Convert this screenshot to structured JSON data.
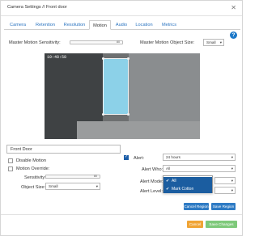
{
  "window": {
    "title": "Camera Settings // Front door"
  },
  "tabs": [
    {
      "label": "Camera"
    },
    {
      "label": "Retention"
    },
    {
      "label": "Resolution"
    },
    {
      "label": "Motion"
    },
    {
      "label": "Audio"
    },
    {
      "label": "Location"
    },
    {
      "label": "Metrics"
    }
  ],
  "active_tab": "Motion",
  "motion": {
    "master_sensitivity_label": "Master Motion Sensitivity:",
    "master_sensitivity_value": "80",
    "master_object_size_label": "Master Motion Object Size:",
    "master_object_size_value": "Small"
  },
  "video": {
    "timestamp": "10:48:58"
  },
  "region": {
    "name": "Front Door",
    "disable_motion_label": "Disable Motion",
    "motion_override_label": "Motion Override:",
    "sensitivity_label": "Sensitivity:",
    "sensitivity_value": "80",
    "object_size_label": "Object Size:",
    "object_size_value": "Small",
    "disable_motion_checked": false,
    "motion_override_checked": false
  },
  "alert": {
    "alert_label": "Alert:",
    "alert_checked": true,
    "alert_value": "24 hours",
    "alert_who_label": "Alert Who:",
    "alert_who_value": "All",
    "alert_who_options": [
      {
        "label": "All",
        "checked": true
      },
      {
        "label": "Mark Cotton",
        "checked": true
      }
    ],
    "alert_mode_label": "Alert Mode:",
    "alert_level_label": "Alert Level:"
  },
  "buttons": {
    "cancel_region": "Cancel Region",
    "save_region": "Save Region",
    "cancel": "Cancel",
    "save_changes": "Save Changes"
  },
  "colors": {
    "primary": "#2e7bc4",
    "warning": "#f0a435",
    "success": "#7ec97a",
    "region_fill": "#8cd1e8",
    "dropdown_highlight": "#1b5da0"
  },
  "icons": {
    "close": "close-icon",
    "help": "help-icon",
    "caret": "chevron-down-icon",
    "check": "checkmark-icon"
  }
}
